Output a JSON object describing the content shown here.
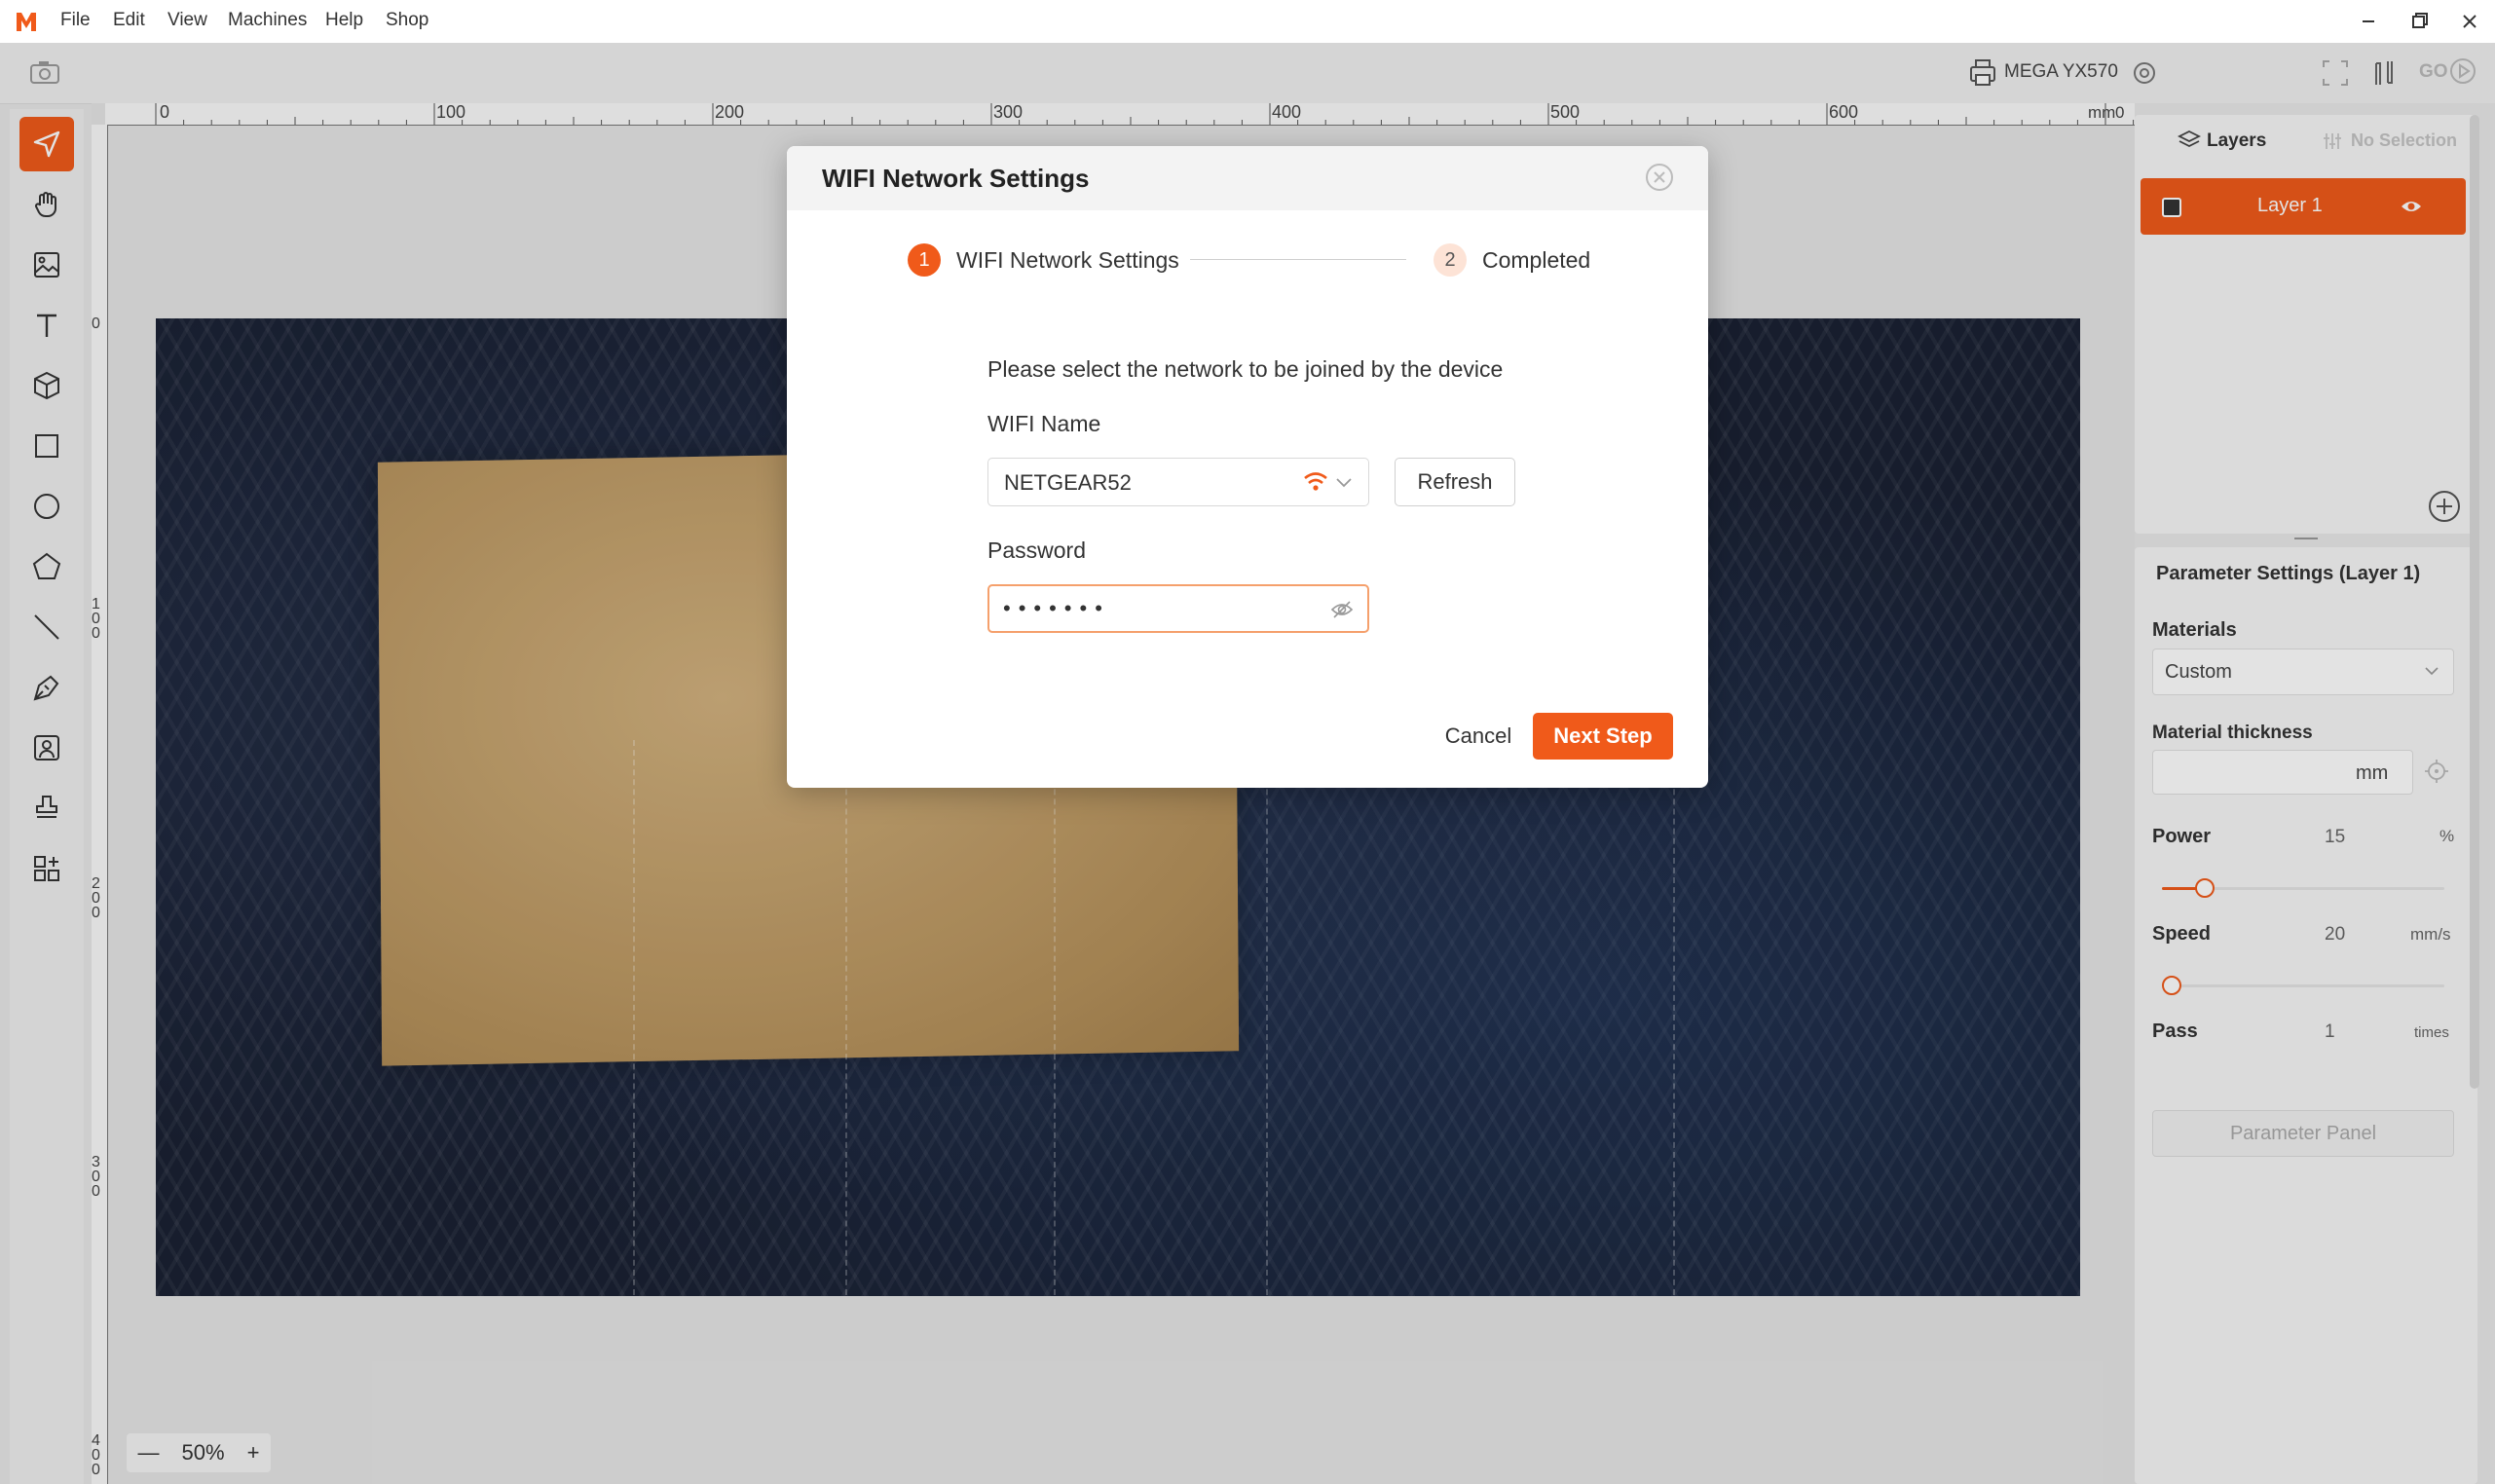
{
  "menubar": {
    "items": [
      "File",
      "Edit",
      "View",
      "Machines",
      "Help",
      "Shop"
    ]
  },
  "toolbar": {
    "device_name": "MEGA YX570",
    "go_label": "GO"
  },
  "ruler": {
    "top_labels": [
      "0",
      "100",
      "200",
      "300",
      "400",
      "500",
      "600"
    ],
    "top_unit": "mm",
    "top_end": "0",
    "left_labels": [
      "0",
      "1\n0\n0",
      "2\n0\n0",
      "3\n0\n0",
      "4\n0\n0"
    ]
  },
  "zoom": {
    "minus": "—",
    "level": "50%",
    "plus": "+"
  },
  "layers_panel": {
    "tab_layers": "Layers",
    "tab_no_selection": "No Selection",
    "layer_name": "Layer 1"
  },
  "param_panel": {
    "title": "Parameter Settings (Layer 1)",
    "materials_label": "Materials",
    "materials_value": "Custom",
    "thickness_label": "Material thickness",
    "thickness_unit": "mm",
    "power_label": "Power",
    "power_value": "15",
    "power_unit": "%",
    "power_fraction": 0.15,
    "speed_label": "Speed",
    "speed_value": "20",
    "speed_unit": "mm/s",
    "speed_fraction": 0.0,
    "pass_label": "Pass",
    "pass_value": "1",
    "pass_unit": "times",
    "panel_button": "Parameter Panel"
  },
  "dialog": {
    "title": "WIFI Network Settings",
    "steps": [
      {
        "number": "1",
        "label": "WIFI Network Settings"
      },
      {
        "number": "2",
        "label": "Completed"
      }
    ],
    "prompt": "Please select the network to be joined by the device",
    "wifi_label": "WIFI Name",
    "wifi_value": "NETGEAR52",
    "refresh_label": "Refresh",
    "password_label": "Password",
    "password_value": "•••••••",
    "cancel_label": "Cancel",
    "next_label": "Next Step"
  },
  "colors": {
    "accent": "#f05a1a",
    "step_inactive_bg": "#fde3d6"
  }
}
